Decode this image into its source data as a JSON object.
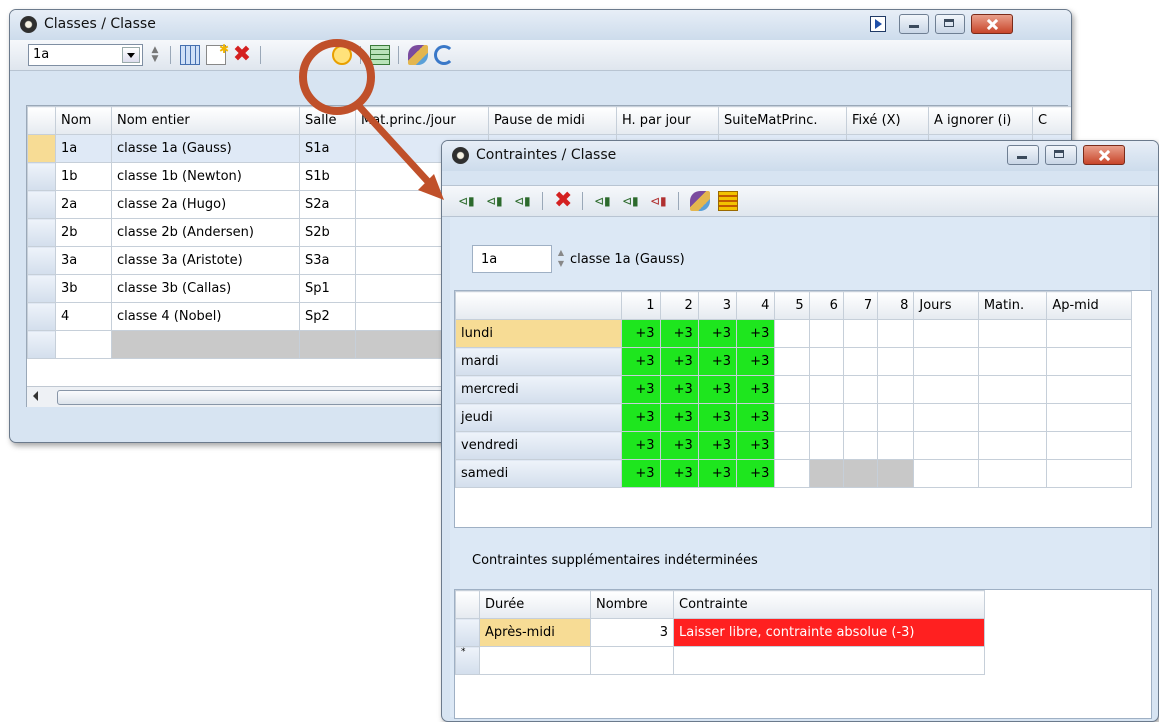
{
  "classes_window": {
    "title": "Classes / Classe",
    "selector_value": "1a",
    "columns": [
      "Nom",
      "Nom entier",
      "Salle",
      "Mat.princ./jour",
      "Pause de midi",
      "H. par jour",
      "SuiteMatPrinc.",
      "Fixé (X)",
      "A ignorer (i)",
      "C"
    ],
    "rows": [
      {
        "nom": "1a",
        "nom_entier": "classe 1a (Gauss)",
        "salle": "S1a"
      },
      {
        "nom": "1b",
        "nom_entier": "classe 1b (Newton)",
        "salle": "S1b"
      },
      {
        "nom": "2a",
        "nom_entier": "classe 2a (Hugo)",
        "salle": "S2a"
      },
      {
        "nom": "2b",
        "nom_entier": "classe 2b (Andersen)",
        "salle": "S2b"
      },
      {
        "nom": "3a",
        "nom_entier": "classe 3a (Aristote)",
        "salle": "S3a"
      },
      {
        "nom": "3b",
        "nom_entier": "classe 3b (Callas)",
        "salle": "Sp1"
      },
      {
        "nom": "4",
        "nom_entier": "classe 4 (Nobel)",
        "salle": "Sp2"
      }
    ]
  },
  "constraints_window": {
    "title": "Contraintes / Classe",
    "class_code": "1a",
    "class_name": "classe 1a (Gauss)",
    "grid_columns": [
      "1",
      "2",
      "3",
      "4",
      "5",
      "6",
      "7",
      "8",
      "Jours",
      "Matin.",
      "Ap-mid"
    ],
    "days": [
      "lundi",
      "mardi",
      "mercredi",
      "jeudi",
      "vendredi",
      "samedi"
    ],
    "cell_value": "+3",
    "section_label": "Contraintes supplémentaires indéterminées",
    "extra_columns": [
      "Durée",
      "Nombre",
      "Contrainte"
    ],
    "extra_row": {
      "duree": "Après-midi",
      "nombre": "3",
      "contrainte": "Laisser libre, contrainte absolue (-3)"
    },
    "new_row_marker": "*"
  },
  "icons": [
    "clock-icon",
    "delete-icon",
    "new-icon",
    "grid-icon",
    "brush-icon",
    "refresh-icon",
    "play-icon"
  ],
  "colors": {
    "green": "#1ee61e",
    "red": "#ff2020",
    "selected": "#f7dc95",
    "callout": "#c0502a"
  }
}
